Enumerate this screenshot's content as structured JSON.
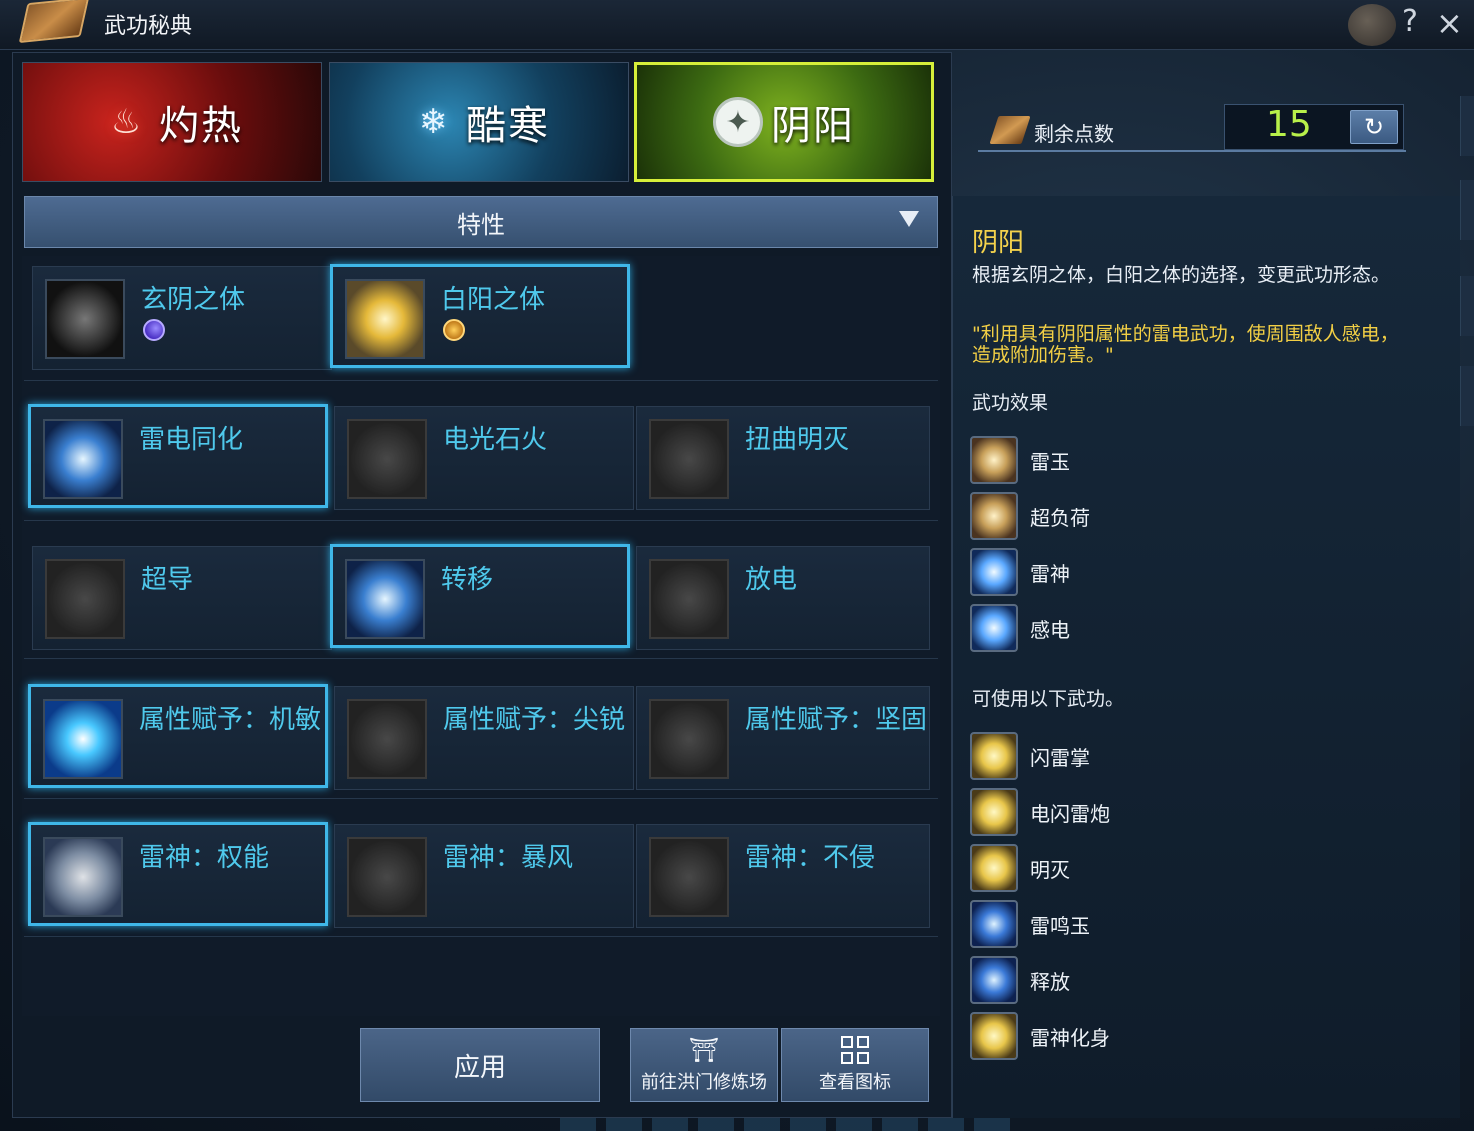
{
  "window": {
    "title": "武功秘典",
    "help_icon": "?",
    "close_icon": "×"
  },
  "tabs": [
    {
      "label": "灼热",
      "icon": "flame-icon",
      "glyph": "♨"
    },
    {
      "label": "酷寒",
      "icon": "snowflake-icon",
      "glyph": "❄"
    },
    {
      "label": "阴阳",
      "icon": "yinyang-star-icon",
      "glyph": "✦",
      "selected": true
    }
  ],
  "filter": {
    "selected": "特性"
  },
  "skills": [
    {
      "name": "玄阴之体",
      "selected": false,
      "badge": "moon-icon"
    },
    {
      "name": "白阳之体",
      "selected": true,
      "badge": "sun-icon"
    },
    {
      "name": "雷电同化",
      "selected": true
    },
    {
      "name": "电光石火",
      "selected": false
    },
    {
      "name": "扭曲明灭",
      "selected": false
    },
    {
      "name": "超导",
      "selected": false
    },
    {
      "name": "转移",
      "selected": true
    },
    {
      "name": "放电",
      "selected": false
    },
    {
      "name": "属性赋予：机敏",
      "selected": true
    },
    {
      "name": "属性赋予：尖锐",
      "selected": false
    },
    {
      "name": "属性赋予：坚固",
      "selected": false
    },
    {
      "name": "雷神：权能",
      "selected": true
    },
    {
      "name": "雷神：暴风",
      "selected": false
    },
    {
      "name": "雷神：不侵",
      "selected": false
    }
  ],
  "buttons": {
    "apply": "应用",
    "training": "前往洪门修炼场",
    "view_icons": "查看图标"
  },
  "points": {
    "label": "剩余点数",
    "value": "15",
    "reset_icon": "↻"
  },
  "info": {
    "title": "阴阳",
    "description": "根据玄阴之体，白阳之体的选择，变更武功形态。",
    "quote_line1": "\"利用具有阴阳属性的雷电武功，使周围敌人感电，",
    "quote_line2": "造成附加伤害。\"",
    "effects_header": "武功效果",
    "effects": [
      "雷玉",
      "超负荷",
      "雷神",
      "感电"
    ],
    "usable_header": "可使用以下武功。",
    "usable": [
      "闪雷掌",
      "电闪雷炮",
      "明灭",
      "雷鸣玉",
      "释放",
      "雷神化身"
    ]
  },
  "colors": {
    "accent_selected": "#3fb7e8",
    "skill_name": "#4fc9ec",
    "points_value": "#b8f04a",
    "info_title": "#f4d24c",
    "quote": "#f2cf45"
  }
}
